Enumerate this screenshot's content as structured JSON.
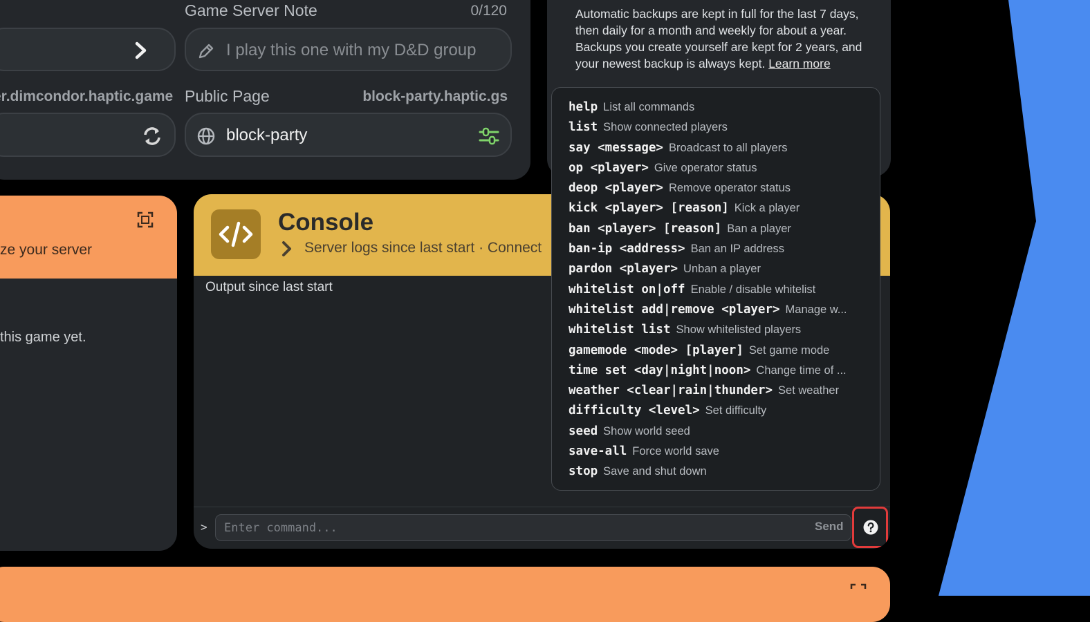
{
  "settings": {
    "note_label": "Game Server Note",
    "note_counter": "0/120",
    "note_placeholder": "I play this one with my D&D group",
    "address_text": "er.dimcondor.haptic.game",
    "public_label": "Public Page",
    "public_domain": "block-party.haptic.gs",
    "public_value": "block-party"
  },
  "backup": {
    "text": "Automatic backups are kept in full for the last 7 days, then daily for a month and weekly for about a year. Backups you create yourself are kept for 2 years, and your newest backup is always kept.",
    "link": "Learn more"
  },
  "left_card": {
    "subtitle": "ze your server",
    "body": "this game yet."
  },
  "console": {
    "title": "Console",
    "subtitle": "Server logs since last start · Connect",
    "output_label": "Output since last start",
    "prompt": ">",
    "input_placeholder": "Enter command...",
    "send_label": "Send"
  },
  "commands": [
    {
      "name": "help",
      "desc": "List all commands"
    },
    {
      "name": "list",
      "desc": "Show connected players"
    },
    {
      "name": "say <message>",
      "desc": "Broadcast to all players"
    },
    {
      "name": "op <player>",
      "desc": "Give operator status"
    },
    {
      "name": "deop <player>",
      "desc": "Remove operator status"
    },
    {
      "name": "kick <player> [reason]",
      "desc": "Kick a player"
    },
    {
      "name": "ban <player> [reason]",
      "desc": "Ban a player"
    },
    {
      "name": "ban-ip <address>",
      "desc": "Ban an IP address"
    },
    {
      "name": "pardon <player>",
      "desc": "Unban a player"
    },
    {
      "name": "whitelist on|off",
      "desc": "Enable / disable whitelist"
    },
    {
      "name": "whitelist add|remove <player>",
      "desc": "Manage w..."
    },
    {
      "name": "whitelist list",
      "desc": "Show whitelisted players"
    },
    {
      "name": "gamemode <mode> [player]",
      "desc": "Set game mode"
    },
    {
      "name": "time set <day|night|noon>",
      "desc": "Change time of ..."
    },
    {
      "name": "weather <clear|rain|thunder>",
      "desc": "Set weather"
    },
    {
      "name": "difficulty <level>",
      "desc": "Set difficulty"
    },
    {
      "name": "seed",
      "desc": "Show world seed"
    },
    {
      "name": "save-all",
      "desc": "Force world save"
    },
    {
      "name": "stop",
      "desc": "Save and shut down"
    }
  ],
  "colors": {
    "background": "#000000",
    "card": "#24272b",
    "orange_accent": "#f89b5c",
    "console_accent": "#e2b54c",
    "blue_accent": "#4a8bf0",
    "help_highlight": "#e23b3b"
  }
}
